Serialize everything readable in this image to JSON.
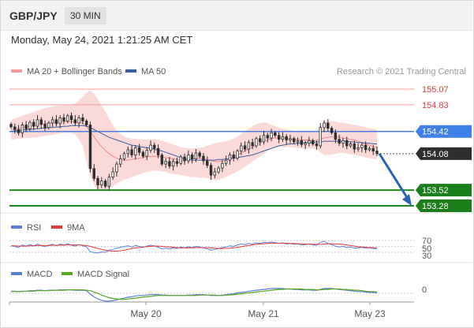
{
  "header": {
    "pair": "GBP/JPY",
    "timeframe": "30 MIN",
    "datetime": "Monday, May 24, 2021 1:21:25 AM CET"
  },
  "main_panel": {
    "legend": [
      {
        "label": "MA 20 + Bollinger Bands",
        "color": "#f49a9a"
      },
      {
        "label": "MA 50",
        "color": "#3a5f9f"
      }
    ],
    "credit": "Research © 2021 Trading Central"
  },
  "rsi_panel": {
    "legend": [
      {
        "label": "RSI",
        "color": "#5b7fd6"
      },
      {
        "label": "9MA",
        "color": "#e23b3b"
      }
    ],
    "levels": [
      "70",
      "50",
      "30"
    ]
  },
  "macd_panel": {
    "legend": [
      {
        "label": "MACD",
        "color": "#5b7fd6"
      },
      {
        "label": "MACD Signal",
        "color": "#5aa822"
      }
    ],
    "zero_label": "0"
  },
  "x_axis": {
    "labels": [
      "May 20",
      "May 21",
      "May 23"
    ]
  },
  "colors": {
    "up_candle": "#2e2e2e",
    "down_candle": "#2e2e2e",
    "resistance": "#f49a9a",
    "support": "#1e8a1e",
    "pivot": "#4a7fe0",
    "arrow": "#2a62b5",
    "band_fill": "#fbd9d9"
  },
  "chart_data": {
    "type": "candlestick",
    "levels": [
      {
        "value": 155.07,
        "label": "155.07",
        "kind": "resistance"
      },
      {
        "value": 154.83,
        "label": "154.83",
        "kind": "resistance"
      },
      {
        "value": 154.42,
        "label": "154.42",
        "kind": "pivot"
      },
      {
        "value": 154.08,
        "label": "154.08",
        "kind": "last"
      },
      {
        "value": 153.52,
        "label": "153.52",
        "kind": "support"
      },
      {
        "value": 153.28,
        "label": "153.28",
        "kind": "support"
      }
    ],
    "close": [
      154.49,
      154.45,
      154.4,
      154.52,
      154.46,
      154.56,
      154.5,
      154.6,
      154.53,
      154.48,
      154.55,
      154.6,
      154.54,
      154.63,
      154.58,
      154.66,
      154.6,
      154.55,
      154.63,
      154.58,
      154.52,
      153.85,
      153.7,
      153.6,
      153.66,
      153.58,
      153.72,
      153.8,
      153.92,
      154.0,
      154.08,
      154.14,
      154.06,
      154.17,
      154.1,
      154.04,
      154.13,
      154.21,
      154.16,
      154.06,
      153.92,
      153.96,
      153.89,
      153.96,
      153.93,
      154.03,
      153.97,
      154.06,
      154.0,
      154.09,
      154.04,
      153.97,
      153.9,
      153.75,
      153.8,
      153.86,
      153.93,
      153.98,
      154.06,
      154.01,
      154.12,
      154.2,
      154.15,
      154.25,
      154.2,
      154.31,
      154.26,
      154.36,
      154.32,
      154.4,
      154.36,
      154.3,
      154.34,
      154.29,
      154.31,
      154.26,
      154.28,
      154.22,
      154.24,
      154.28,
      154.23,
      154.2,
      154.48,
      154.55,
      154.47,
      154.4,
      154.3,
      154.24,
      154.28,
      154.2,
      154.23,
      154.15,
      154.17,
      154.21,
      154.14,
      154.16,
      154.12,
      154.08
    ],
    "ma20": [
      154.45,
      154.46,
      154.47,
      154.48,
      154.49,
      154.5,
      154.51,
      154.52,
      154.53,
      154.54,
      154.55,
      154.55,
      154.56,
      154.56,
      154.57,
      154.57,
      154.57,
      154.57,
      154.56,
      154.55,
      154.5,
      154.42,
      154.34,
      154.26,
      154.19,
      154.13,
      154.08,
      154.04,
      154.01,
      153.99,
      153.98,
      153.98,
      153.99,
      154.0,
      154.01,
      154.02,
      154.03,
      154.04,
      154.04,
      154.04,
      154.03,
      154.02,
      154.01,
      154.0,
      153.99,
      153.98,
      153.98,
      153.99,
      154.0,
      154.01,
      154.01,
      154.0,
      153.99,
      153.97,
      153.96,
      153.96,
      153.97,
      153.98,
      154.0,
      154.03,
      154.06,
      154.09,
      154.12,
      154.15,
      154.18,
      154.21,
      154.24,
      154.27,
      154.29,
      154.31,
      154.32,
      154.32,
      154.32,
      154.31,
      154.31,
      154.3,
      154.3,
      154.29,
      154.29,
      154.29,
      154.28,
      154.28,
      154.3,
      154.32,
      154.33,
      154.34,
      154.34,
      154.33,
      154.32,
      154.31,
      154.3,
      154.29,
      154.27,
      154.25,
      154.23,
      154.21,
      154.19,
      154.17
    ],
    "ma50": [
      154.42,
      154.43,
      154.44,
      154.44,
      154.45,
      154.45,
      154.46,
      154.46,
      154.47,
      154.47,
      154.48,
      154.48,
      154.49,
      154.49,
      154.5,
      154.5,
      154.51,
      154.51,
      154.51,
      154.51,
      154.5,
      154.48,
      154.45,
      154.42,
      154.39,
      154.36,
      154.33,
      154.31,
      154.29,
      154.27,
      154.25,
      154.23,
      154.21,
      154.2,
      154.19,
      154.18,
      154.17,
      154.16,
      154.15,
      154.13,
      154.12,
      154.1,
      154.08,
      154.06,
      154.04,
      154.02,
      154.0,
      153.99,
      153.98,
      153.98,
      153.98,
      153.98,
      153.98,
      153.98,
      153.98,
      153.99,
      153.99,
      154.0,
      154.0,
      154.01,
      154.02,
      154.03,
      154.04,
      154.05,
      154.06,
      154.08,
      154.1,
      154.12,
      154.14,
      154.16,
      154.18,
      154.2,
      154.21,
      154.22,
      154.23,
      154.23,
      154.24,
      154.24,
      154.25,
      154.25,
      154.25,
      154.26,
      154.26,
      154.27,
      154.27,
      154.27,
      154.27,
      154.27,
      154.27,
      154.27,
      154.26,
      154.26,
      154.25,
      154.25,
      154.24,
      154.24,
      154.23,
      154.23
    ],
    "bb_upper": [
      154.6,
      154.62,
      154.64,
      154.66,
      154.68,
      154.7,
      154.72,
      154.74,
      154.76,
      154.78,
      154.79,
      154.8,
      154.81,
      154.82,
      154.82,
      154.82,
      154.83,
      154.85,
      154.9,
      154.95,
      155.02,
      155.05,
      155.0,
      154.92,
      154.82,
      154.72,
      154.62,
      154.52,
      154.44,
      154.38,
      154.34,
      154.32,
      154.31,
      154.31,
      154.3,
      154.3,
      154.3,
      154.3,
      154.3,
      154.29,
      154.28,
      154.26,
      154.24,
      154.22,
      154.2,
      154.18,
      154.17,
      154.16,
      154.16,
      154.16,
      154.17,
      154.18,
      154.2,
      154.22,
      154.24,
      154.25,
      154.26,
      154.27,
      154.29,
      154.31,
      154.34,
      154.38,
      154.42,
      154.46,
      154.5,
      154.53,
      154.55,
      154.56,
      154.55,
      154.52,
      154.5,
      154.48,
      154.46,
      154.45,
      154.44,
      154.43,
      154.42,
      154.42,
      154.42,
      154.42,
      154.42,
      154.43,
      154.5,
      154.56,
      154.58,
      154.58,
      154.57,
      154.56,
      154.55,
      154.54,
      154.53,
      154.52,
      154.51,
      154.5,
      154.48,
      154.47,
      154.46,
      154.44
    ],
    "bb_lower": [
      154.3,
      154.3,
      154.31,
      154.31,
      154.32,
      154.32,
      154.33,
      154.33,
      154.34,
      154.35,
      154.36,
      154.37,
      154.38,
      154.39,
      154.4,
      154.4,
      154.4,
      154.38,
      154.3,
      154.2,
      153.95,
      153.75,
      153.6,
      153.52,
      153.5,
      153.52,
      153.55,
      153.58,
      153.62,
      153.65,
      153.68,
      153.7,
      153.72,
      153.74,
      153.76,
      153.78,
      153.8,
      153.81,
      153.82,
      153.82,
      153.81,
      153.8,
      153.78,
      153.77,
      153.76,
      153.75,
      153.74,
      153.73,
      153.72,
      153.72,
      153.71,
      153.71,
      153.7,
      153.68,
      153.67,
      153.68,
      153.7,
      153.72,
      153.75,
      153.78,
      153.81,
      153.84,
      153.88,
      153.92,
      153.96,
      154.0,
      154.04,
      154.08,
      154.12,
      154.15,
      154.17,
      154.18,
      154.18,
      154.18,
      154.18,
      154.17,
      154.17,
      154.16,
      154.16,
      154.16,
      154.16,
      154.15,
      154.1,
      154.06,
      154.06,
      154.07,
      154.08,
      154.09,
      154.09,
      154.08,
      154.07,
      154.06,
      154.05,
      154.04,
      154.02,
      154.01,
      154.0,
      153.99
    ],
    "rsi": [
      52,
      50,
      46,
      55,
      51,
      56,
      52,
      58,
      53,
      49,
      54,
      57,
      52,
      58,
      55,
      59,
      54,
      51,
      56,
      52,
      49,
      32,
      29,
      28,
      31,
      30,
      37,
      40,
      44,
      47,
      50,
      52,
      48,
      53,
      50,
      47,
      51,
      54,
      52,
      47,
      42,
      44,
      41,
      45,
      43,
      48,
      45,
      49,
      46,
      50,
      48,
      45,
      42,
      37,
      40,
      43,
      46,
      48,
      52,
      50,
      55,
      58,
      56,
      60,
      58,
      62,
      60,
      64,
      62,
      65,
      63,
      60,
      62,
      58,
      60,
      57,
      58,
      55,
      56,
      58,
      55,
      54,
      64,
      67,
      60,
      56,
      51,
      48,
      50,
      46,
      48,
      44,
      45,
      47,
      44,
      45,
      43,
      41
    ],
    "rsi_ma": [
      52,
      52,
      51,
      51,
      51,
      52,
      52,
      53,
      53,
      53,
      53,
      54,
      54,
      54,
      54,
      55,
      55,
      55,
      55,
      54,
      53,
      50,
      46,
      43,
      40,
      37,
      35,
      34,
      34,
      35,
      37,
      40,
      43,
      45,
      46,
      48,
      49,
      50,
      51,
      51,
      50,
      49,
      48,
      47,
      46,
      45,
      45,
      45,
      45,
      46,
      46,
      46,
      46,
      45,
      44,
      43,
      43,
      43,
      44,
      45,
      47,
      49,
      51,
      53,
      55,
      57,
      58,
      59,
      60,
      61,
      61,
      61,
      61,
      61,
      60,
      60,
      59,
      59,
      58,
      58,
      57,
      57,
      57,
      58,
      59,
      59,
      58,
      58,
      57,
      55,
      53,
      51,
      49,
      48,
      47,
      46,
      46,
      45
    ],
    "macd": [
      0.05,
      0.05,
      0.04,
      0.05,
      0.05,
      0.06,
      0.06,
      0.07,
      0.07,
      0.06,
      0.07,
      0.07,
      0.07,
      0.08,
      0.08,
      0.08,
      0.08,
      0.07,
      0.07,
      0.07,
      0.06,
      -0.02,
      -0.08,
      -0.13,
      -0.16,
      -0.18,
      -0.18,
      -0.17,
      -0.15,
      -0.13,
      -0.11,
      -0.09,
      -0.08,
      -0.06,
      -0.05,
      -0.05,
      -0.04,
      -0.03,
      -0.03,
      -0.03,
      -0.04,
      -0.04,
      -0.05,
      -0.05,
      -0.05,
      -0.05,
      -0.05,
      -0.04,
      -0.04,
      -0.03,
      -0.03,
      -0.03,
      -0.04,
      -0.05,
      -0.05,
      -0.05,
      -0.04,
      -0.03,
      -0.02,
      -0.01,
      0.01,
      0.02,
      0.03,
      0.05,
      0.06,
      0.07,
      0.08,
      0.09,
      0.1,
      0.11,
      0.11,
      0.11,
      0.11,
      0.1,
      0.1,
      0.09,
      0.09,
      0.08,
      0.08,
      0.08,
      0.07,
      0.07,
      0.09,
      0.11,
      0.11,
      0.11,
      0.1,
      0.09,
      0.08,
      0.07,
      0.06,
      0.05,
      0.04,
      0.04,
      0.03,
      0.02,
      0.02,
      0.01
    ],
    "macd_signal": [
      0.04,
      0.04,
      0.04,
      0.04,
      0.05,
      0.05,
      0.05,
      0.06,
      0.06,
      0.06,
      0.06,
      0.07,
      0.07,
      0.07,
      0.07,
      0.08,
      0.08,
      0.08,
      0.08,
      0.08,
      0.07,
      0.06,
      0.03,
      0.0,
      -0.04,
      -0.07,
      -0.1,
      -0.12,
      -0.13,
      -0.14,
      -0.14,
      -0.13,
      -0.12,
      -0.11,
      -0.1,
      -0.09,
      -0.08,
      -0.07,
      -0.06,
      -0.05,
      -0.05,
      -0.05,
      -0.05,
      -0.05,
      -0.05,
      -0.05,
      -0.05,
      -0.05,
      -0.05,
      -0.05,
      -0.04,
      -0.04,
      -0.04,
      -0.04,
      -0.04,
      -0.05,
      -0.05,
      -0.04,
      -0.04,
      -0.03,
      -0.02,
      -0.01,
      0.0,
      0.01,
      0.02,
      0.03,
      0.04,
      0.05,
      0.06,
      0.07,
      0.08,
      0.09,
      0.09,
      0.1,
      0.1,
      0.1,
      0.1,
      0.1,
      0.09,
      0.09,
      0.09,
      0.08,
      0.08,
      0.09,
      0.09,
      0.1,
      0.1,
      0.1,
      0.09,
      0.09,
      0.08,
      0.07,
      0.07,
      0.06,
      0.05,
      0.04,
      0.04,
      0.03
    ],
    "projection": {
      "from": 154.08,
      "to": 153.28
    }
  }
}
